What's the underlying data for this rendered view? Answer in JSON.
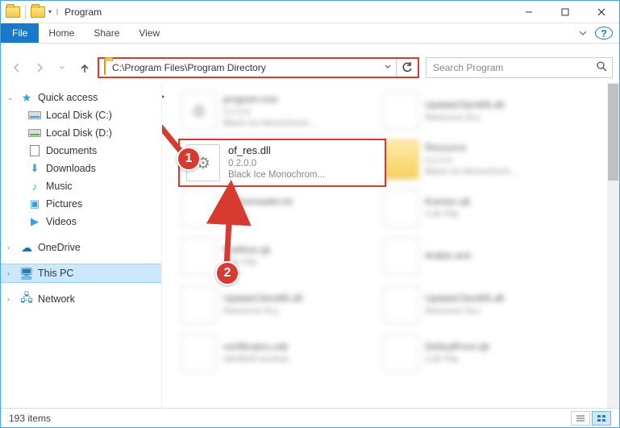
{
  "window": {
    "title": "Program"
  },
  "ribbon": {
    "file": "File",
    "tabs": [
      "Home",
      "Share",
      "View"
    ]
  },
  "nav": {
    "path": "C:\\Program Files\\Program Directory",
    "refresh_title": "Refresh"
  },
  "search": {
    "placeholder": "Search Program"
  },
  "sidebar": {
    "quick_access": "Quick access",
    "items": [
      "Local Disk (C:)",
      "Local Disk (D:)",
      "Documents",
      "Downloads",
      "Music",
      "Pictures",
      "Videos"
    ],
    "onedrive": "OneDrive",
    "this_pc": "This PC",
    "network": "Network"
  },
  "highlighted_file": {
    "name": "of_res.dll",
    "version": "0.2.0.0",
    "description": "Black Ice Monochrom..."
  },
  "blurred_files": [
    {
      "name": "program.exe",
      "sub1": "0.2.0.0",
      "sub2": "Black Ice Monochrom...",
      "icon": "gear"
    },
    {
      "name": "UpdateClient65.dll",
      "sub1": "Resource DLL",
      "sub2": "",
      "icon": "doc"
    },
    {
      "name": "",
      "sub1": "",
      "sub2": "",
      "icon": "gear"
    },
    {
      "name": "Resource",
      "sub1": "0.2.0.0",
      "sub2": "Black Ice Monochrom...",
      "icon": "folder"
    },
    {
      "name": "hp.finereader.txt",
      "sub1": "File",
      "sub2": "",
      "icon": "doc"
    },
    {
      "name": "Korean.cjk",
      "sub1": "CJK File",
      "sub2": "",
      "icon": "doc"
    },
    {
      "name": "findNml.cjk",
      "sub1": "CJK File",
      "sub2": "",
      "icon": "doc"
    },
    {
      "name": "Arabic.wrd",
      "sub1": "",
      "sub2": "",
      "icon": "doc"
    },
    {
      "name": "UpdateClient65.dll",
      "sub1": "Resource DLL",
      "sub2": "",
      "icon": "doc"
    },
    {
      "name": "UpdateClient65.dll",
      "sub1": "Resource DLL",
      "sub2": "",
      "icon": "doc"
    },
    {
      "name": "certificates.cab",
      "sub1": "WinRAR Archive",
      "sub2": "",
      "icon": "doc"
    },
    {
      "name": "DefaultFont.cjk",
      "sub1": "CJK File",
      "sub2": "",
      "icon": "doc"
    }
  ],
  "callouts": {
    "one": "1",
    "two": "2"
  },
  "status": {
    "text": "193 items"
  }
}
